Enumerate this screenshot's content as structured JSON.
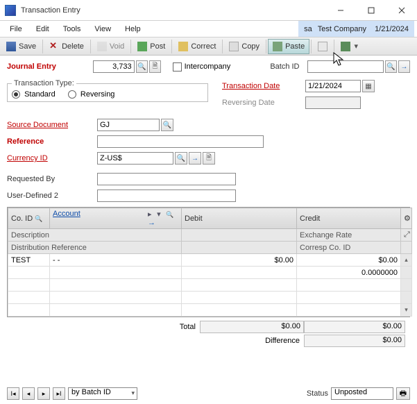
{
  "window": {
    "title": "Transaction Entry"
  },
  "menus": {
    "file": "File",
    "edit": "Edit",
    "tools": "Tools",
    "view": "View",
    "help": "Help"
  },
  "context": {
    "user": "sa",
    "company": "Test Company",
    "date": "1/21/2024"
  },
  "toolbar": {
    "save": "Save",
    "delete": "Delete",
    "void": "Void",
    "post": "Post",
    "correct": "Correct",
    "copy": "Copy",
    "paste": "Paste"
  },
  "form": {
    "journal_entry_label": "Journal Entry",
    "journal_entry_value": "3,733",
    "intercompany_label": "Intercompany",
    "batch_id_label": "Batch ID",
    "batch_id_value": "",
    "transaction_type_label": "Transaction Type:",
    "radio_standard": "Standard",
    "radio_reversing": "Reversing",
    "transaction_date_label": "Transaction Date",
    "transaction_date_value": "1/21/2024",
    "reversing_date_label": "Reversing Date",
    "source_doc_label": "Source Document",
    "source_doc_value": "GJ",
    "reference_label": "Reference",
    "reference_value": "",
    "currency_id_label": "Currency ID",
    "currency_id_value": "Z-US$",
    "requested_by_label": "Requested By",
    "requested_by_value": "",
    "userdef2_label": "User-Defined 2",
    "userdef2_value": ""
  },
  "grid": {
    "headers": {
      "co_id": "Co. ID",
      "account": "Account",
      "debit": "Debit",
      "credit": "Credit",
      "description": "Description",
      "exchange_rate": "Exchange Rate",
      "dist_ref": "Distribution Reference",
      "corresp_co": "Corresp Co. ID"
    },
    "rows": [
      {
        "co": "TEST",
        "acct": "-       -",
        "debit": "$0.00",
        "credit": "$0.00"
      },
      {
        "co": "",
        "acct": "",
        "debit": "",
        "credit": "0.0000000"
      }
    ]
  },
  "totals": {
    "total_label": "Total",
    "total_debit": "$0.00",
    "total_credit": "$0.00",
    "difference_label": "Difference",
    "difference_value": "$0.00"
  },
  "footer": {
    "sort_by": "by Batch ID",
    "status_label": "Status",
    "status_value": "Unposted"
  }
}
